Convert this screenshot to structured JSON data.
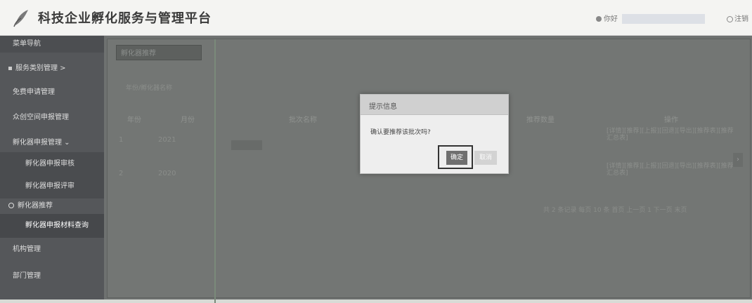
{
  "header": {
    "title": "科技企业孵化服务与管理平台",
    "user_label": "你好",
    "logout_label": "注销"
  },
  "sidebar": {
    "top_label": "菜单导航",
    "items": [
      {
        "label": "服务类别管理  >",
        "kind": "group"
      },
      {
        "label": "免费申请管理",
        "kind": "item"
      },
      {
        "label": "众创空间申报管理",
        "kind": "item"
      },
      {
        "label": "孵化器申报管理  ⌄",
        "kind": "item"
      },
      {
        "label": "孵化器申报审核",
        "kind": "sub"
      },
      {
        "label": "孵化器申报评审",
        "kind": "sub"
      },
      {
        "label": "孵化器推荐",
        "kind": "group-active"
      },
      {
        "label": "孵化器申报材料查询",
        "kind": "sub"
      },
      {
        "label": "机构管理",
        "kind": "item"
      },
      {
        "label": "部门管理",
        "kind": "item"
      }
    ]
  },
  "main": {
    "tab_label": "孵化器推荐",
    "filter_text": "年份/孵化器名称",
    "columns": [
      "年份",
      "月份",
      "批次名称",
      "推荐数量",
      "操作"
    ],
    "rows": [
      {
        "index": "1",
        "year": "2021"
      },
      {
        "index": "2",
        "year": "2020"
      }
    ],
    "ops_row1": "[详情][推荐][上报][回退][导出][推荐表][推荐汇总表]",
    "ops_row2": "[详情][推荐][上报][回退][导出][推荐表][推荐汇总表]",
    "pager": "共 2 条记录  每页 10 条  首页 上一页 1 下一页 末页"
  },
  "modal": {
    "title": "提示信息",
    "message": "确认要推荐该批次吗?",
    "ok_label": "确定",
    "cancel_label": "取消"
  }
}
